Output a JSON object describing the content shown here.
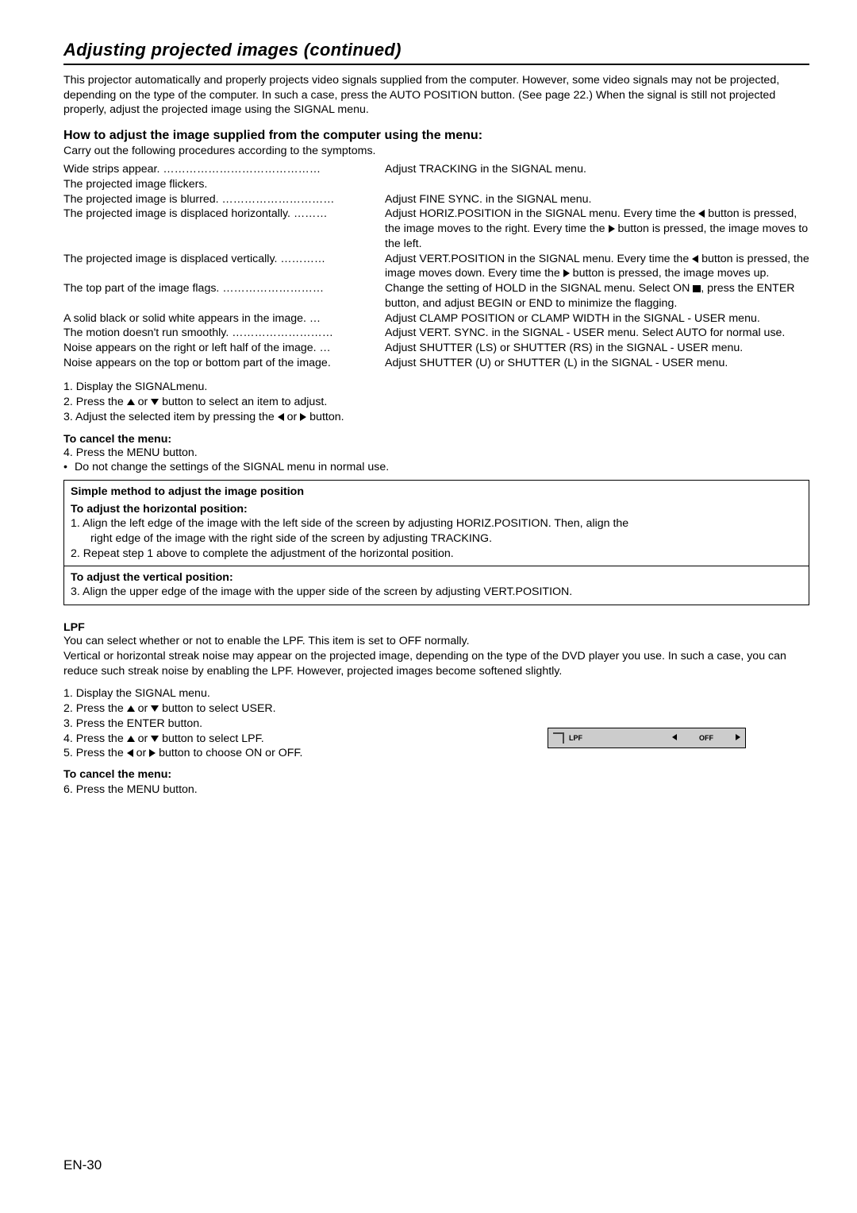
{
  "title": "Adjusting projected images (continued)",
  "intro": "This projector automatically and properly projects video signals supplied from the computer. However, some video signals may not be projected, depending on the type of the computer. In such a case, press the AUTO POSITION button. (See page 22.) When the signal is still not projected properly, adjust the projected image using the SIGNAL menu.",
  "howto_heading": "How to adjust the image supplied from the computer using the menu:",
  "carry_line": "Carry out the following procedures according to the symptoms.",
  "symptoms": {
    "r1l": "Wide strips appear.  ……………………………………",
    "r1r": "Adjust TRACKING in the SIGNAL menu.",
    "r2l": "The projected image flickers.",
    "r3l": "The projected image is blurred. …………………………",
    "r3r": "Adjust FINE SYNC. in the SIGNAL menu.",
    "r4l": "The projected image is displaced horizontally.   ………",
    "r4r1": "Adjust HORIZ.POSITION in the SIGNAL menu. Every time the ",
    "r4r2": " button is pressed, the image moves to the right. Every time the ",
    "r4r3": " button is pressed, the image moves to the left.",
    "r5l": "The projected image is displaced vertically.    …………",
    "r5r1": "Adjust VERT.POSITION in the SIGNAL menu. Every time the ",
    "r5r2": " button is pressed, the image moves down. Every time the ",
    "r5r3": " button is pressed, the image moves up.",
    "r6l": "The top part of the image flags.    ………………………",
    "r6r1": "Change the setting of HOLD in the SIGNAL menu. Select ON ",
    "r6r2": ", press the ENTER button, and adjust BEGIN or END to minimize the flagging.",
    "r7l": "A solid black or solid white appears in the image.    …",
    "r7r": "Adjust CLAMP POSITION or CLAMP WIDTH in the SIGNAL - USER menu.",
    "r8l": "The motion doesn't run smoothly. ………………………",
    "r8r": "Adjust VERT. SYNC. in the SIGNAL - USER menu. Select AUTO for normal use.",
    "r9l": "Noise appears on the right or left half of the image.  …",
    "r9r": "Adjust SHUTTER (LS) or SHUTTER (RS) in the SIGNAL - USER menu.",
    "r10l": "Noise appears on the top or bottom part of the image.",
    "r10r": "Adjust SHUTTER (U) or SHUTTER (L) in the SIGNAL - USER menu."
  },
  "steps1": {
    "s1": "1.  Display the SIGNALmenu.",
    "s2a": "2.  Press the ",
    "s2b": " or ",
    "s2c": " button to select an item to adjust.",
    "s3a": "3.  Adjust the selected item by pressing the ",
    "s3b": " or ",
    "s3c": " button."
  },
  "cancel1_title": "To cancel the menu:",
  "cancel1_step": "4.  Press the MENU button.",
  "cancel1_note": "Do not change the settings of the SIGNAL menu in normal use.",
  "box": {
    "title": "Simple method to adjust the image position",
    "h_title": "To adjust the horizontal position:",
    "h1": "1.  Align the left edge of the image with the left side of the screen by adjusting HORIZ.POSITION. Then, align the",
    "h1b": "right edge of the image with the right side of the screen by adjusting TRACKING.",
    "h2": "2.  Repeat step 1 above to complete the adjustment of the horizontal position.",
    "v_title": "To adjust the vertical position:",
    "v1": "3.  Align the upper edge of the image with the upper side of the screen by adjusting VERT.POSITION."
  },
  "lpf": {
    "heading": "LPF",
    "p1": "You can select whether or not to enable the LPF. This item is set to OFF normally.",
    "p2": "Vertical or horizontal streak noise may appear on the projected image, depending on the type of the DVD player you use. In such a case, you can reduce such streak noise by enabling the LPF. However, projected images become softened slightly.",
    "s1": "1.  Display the SIGNAL menu.",
    "s2a": "2.  Press the ",
    "s2b": " or ",
    "s2c": " button to select USER.",
    "s3": "3.  Press the ENTER button.",
    "s4a": "4.  Press the ",
    "s4b": " or ",
    "s4c": " button to select LPF.",
    "s5a": "5.  Press the ",
    "s5b": " or ",
    "s5c": " button to choose ON or OFF.",
    "widget_label": "LPF",
    "widget_value": "OFF"
  },
  "cancel2_title": "To cancel the menu:",
  "cancel2_step": "6.  Press the MENU button.",
  "page_number": "EN-30"
}
